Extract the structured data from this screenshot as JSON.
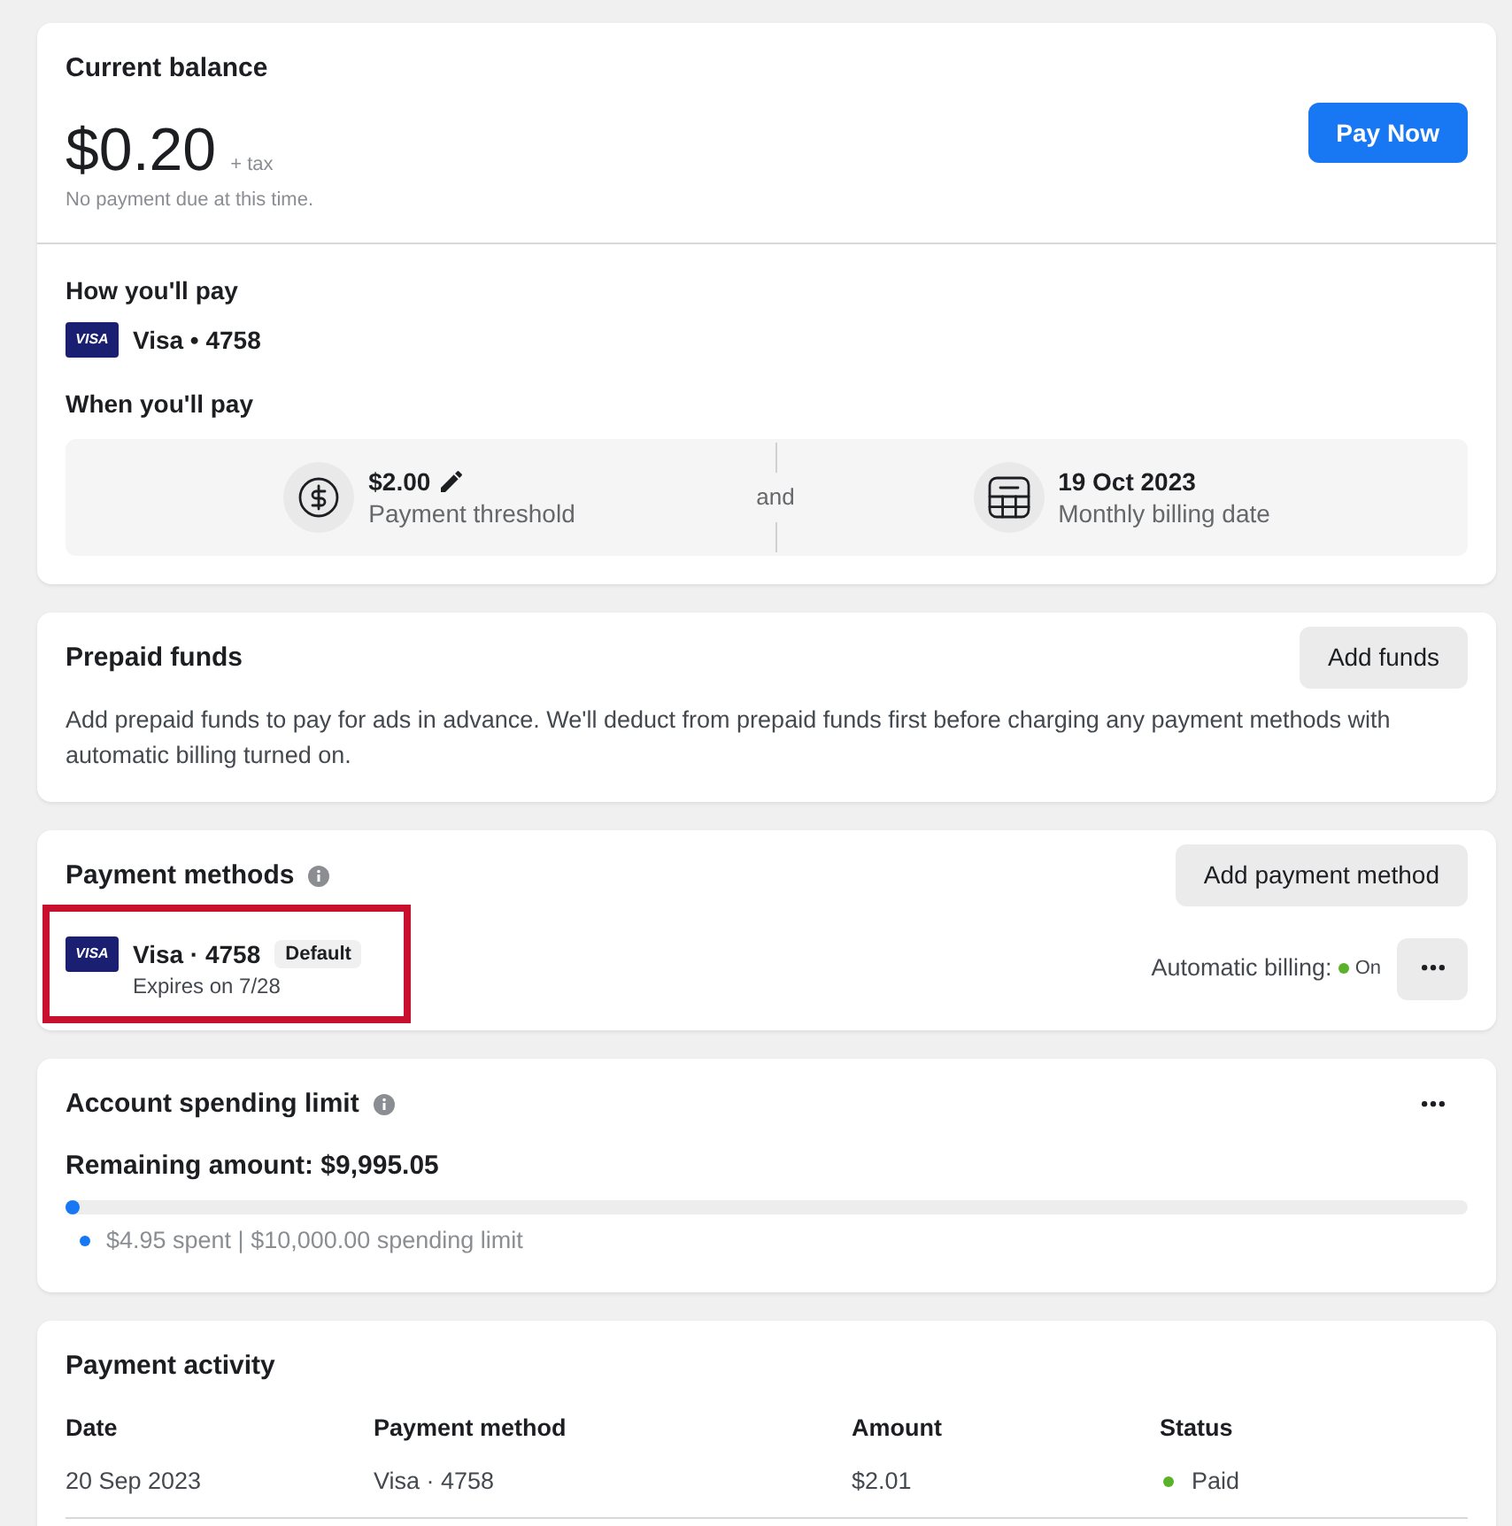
{
  "current_balance": {
    "title": "Current balance",
    "amount": "$0.20",
    "tax_note": "+ tax",
    "due_note": "No payment due at this time.",
    "pay_button": "Pay Now"
  },
  "how_you_pay": {
    "title": "How you'll pay",
    "card": {
      "logo": "VISA",
      "label": "Visa • 4758"
    }
  },
  "when_you_pay": {
    "title": "When you'll pay",
    "threshold": {
      "value": "$2.00",
      "label": "Payment threshold"
    },
    "separator": "and",
    "billing_date": {
      "value": "19 Oct 2023",
      "label": "Monthly billing date"
    }
  },
  "prepaid_funds": {
    "title": "Prepaid funds",
    "button": "Add funds",
    "description": "Add prepaid funds to pay for ads in advance. We'll deduct from prepaid funds first before charging any payment methods with automatic billing turned on."
  },
  "payment_methods": {
    "title": "Payment methods",
    "button": "Add payment method",
    "items": [
      {
        "logo": "VISA",
        "label": "Visa · 4758",
        "badge": "Default",
        "expiry": "Expires on 7/28",
        "highlighted": true,
        "automatic_billing": {
          "label": "Automatic billing:",
          "value": "On",
          "on": true
        }
      }
    ]
  },
  "spending_limit": {
    "title": "Account spending limit",
    "remaining": "Remaining amount: $9,995.05",
    "level": 0.0005,
    "legend": "$4.95 spent | $10,000.00 spending limit"
  },
  "payment_activity": {
    "title": "Payment activity",
    "columns": [
      "Date",
      "Payment method",
      "Amount",
      "Status"
    ],
    "rows": [
      {
        "date": "20 Sep 2023",
        "payment_method": "Visa · 4758",
        "amount": "$2.01",
        "status": "Paid",
        "color": "#5ab22a"
      }
    ]
  }
}
